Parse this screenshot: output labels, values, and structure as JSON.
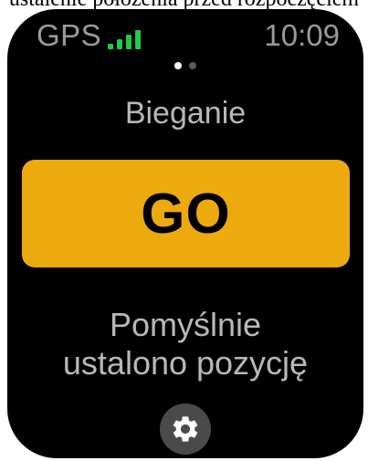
{
  "caption": "ustalenie położenia przed rozpoczęciem",
  "status_bar": {
    "gps_label": "GPS",
    "signal_bars": 4,
    "time": "10:09"
  },
  "pagination": {
    "pages": 2,
    "active": 0
  },
  "activity": {
    "name": "Bieganie"
  },
  "go_button": {
    "label": "GO"
  },
  "status": {
    "line1": "Pomyślnie",
    "line2": "ustalono pozycję"
  },
  "settings_button": {
    "icon": "gear-icon"
  },
  "colors": {
    "background": "#000000",
    "accent": "#ecaa0f",
    "signal": "#1fcc4a",
    "text_gray": "#b8b8b8",
    "status_gray": "#9a9a9a",
    "dot_active": "#ffffff",
    "dot_inactive": "#5a5a5a",
    "settings_bg": "#4a4a4a",
    "settings_icon": "#ffffff"
  }
}
